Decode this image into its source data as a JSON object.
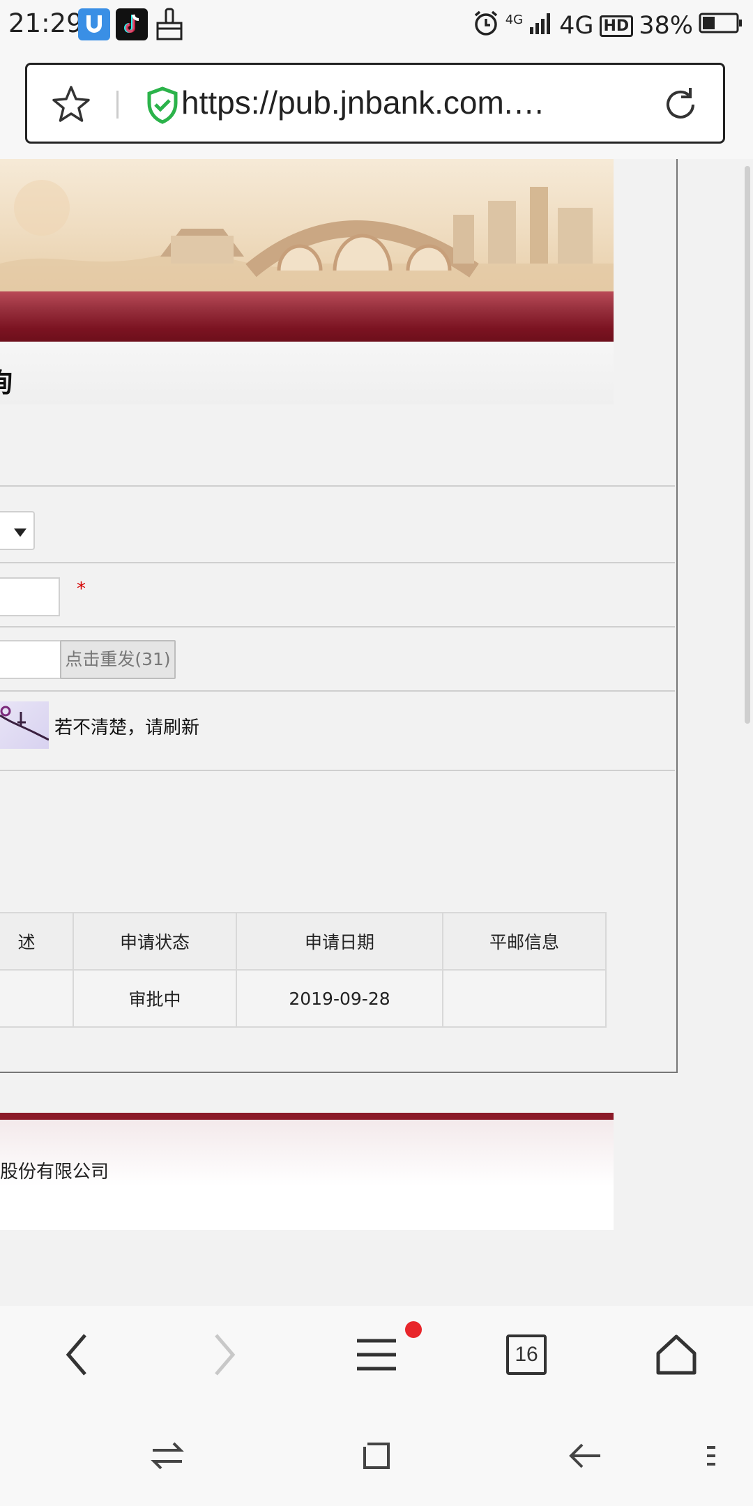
{
  "status_bar": {
    "time": "21:29",
    "net_small": "4G",
    "net_main": "4G",
    "hd": "HD",
    "battery": "38%",
    "battery_level": 0.38,
    "left_icons": [
      "tiktok-icon",
      "uc-shield-icon",
      "brush-icon"
    ],
    "right_icons": [
      "alarm-icon",
      "signal-icon",
      "battery-icon"
    ]
  },
  "browser": {
    "url": "https://pub.jnbank.com.…",
    "tab_count": "16",
    "menu_has_badge": true
  },
  "page": {
    "title_fragment": "询",
    "required_mark": "*",
    "resend_label": "点击重发(31)",
    "captcha_hint": "若不清楚，请刷新",
    "table": {
      "headers": [
        "述",
        "申请状态",
        "申请日期",
        "平邮信息"
      ],
      "rows": [
        [
          "",
          "审批中",
          "2019-09-28",
          ""
        ]
      ]
    },
    "footer_text": "股份有限公司"
  },
  "colors": {
    "bank_red": "#7b1321",
    "shield_green": "#2bb34a",
    "badge_red": "#e8262b"
  }
}
